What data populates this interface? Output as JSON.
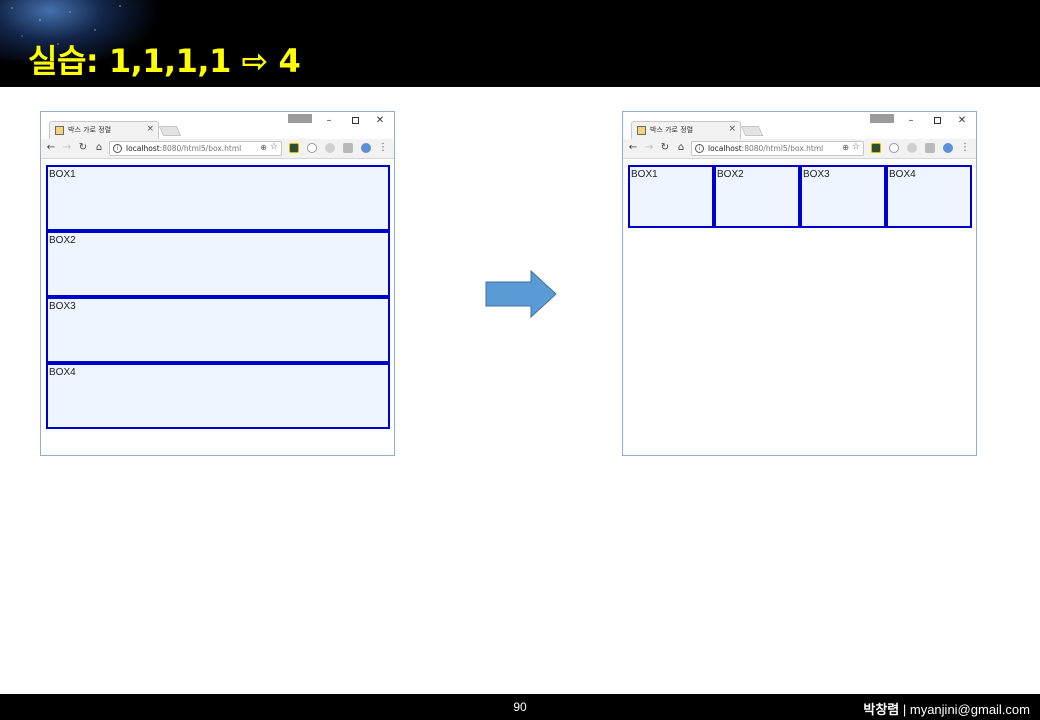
{
  "slide": {
    "title": "실습: 1,1,1,1 ⇨ 4",
    "page_number": "90",
    "author_name": "박창렴",
    "author_separator": " | ",
    "author_email": "myanjini@gmail.com"
  },
  "colors": {
    "title": "#ffff00",
    "box_border": "#0000cc",
    "box_fill": "#eef5ff",
    "arrow_fill": "#5b9bd5",
    "arrow_stroke": "#41719c"
  },
  "browser": {
    "tab_title": "박스 가로 정렬",
    "tab_close": "×",
    "url_host": "localhost",
    "url_rest": ":8080/html5/box.html",
    "icons": [
      "back-arrow-icon",
      "forward-arrow-icon",
      "reload-icon",
      "home-icon",
      "info-icon",
      "zoom-icon",
      "star-icon",
      "menu-icon"
    ]
  },
  "left_window": {
    "layout": "vertical",
    "boxes": [
      "BOX1",
      "BOX2",
      "BOX3",
      "BOX4"
    ]
  },
  "right_window": {
    "layout": "horizontal",
    "boxes": [
      "BOX1",
      "BOX2",
      "BOX3",
      "BOX4"
    ]
  }
}
